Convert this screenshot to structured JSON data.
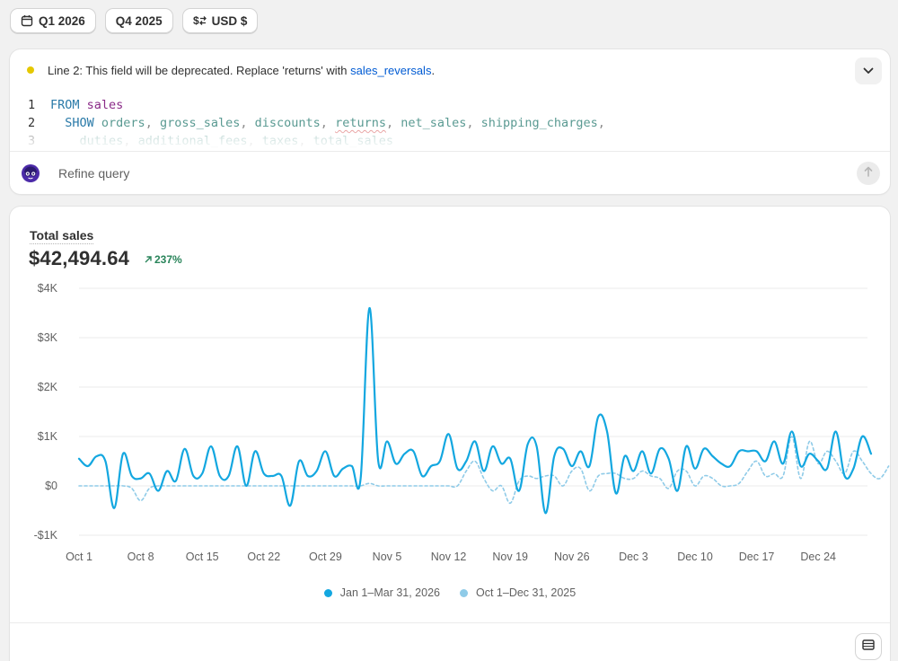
{
  "filters": [
    {
      "label": "Q1 2026",
      "icon": "calendar-icon"
    },
    {
      "label": "Q4 2025",
      "icon": ""
    },
    {
      "label": "USD $",
      "icon": "currency-exchange-icon"
    }
  ],
  "query": {
    "warning": {
      "text": "Line 2: This field will be deprecated. Replace 'returns' with ",
      "replacement": "sales_reversals",
      "suffix": ".",
      "status_color": "#e5c800"
    },
    "code_lines": [
      {
        "number": "1",
        "keyword": "FROM",
        "rest": [
          {
            "t": "sales",
            "c": "id"
          }
        ]
      },
      {
        "number": "2",
        "keyword": "SHOW",
        "rest": [
          {
            "t": "orders",
            "c": "fld"
          },
          {
            "t": ", ",
            "c": "punct"
          },
          {
            "t": "gross_sales",
            "c": "fld"
          },
          {
            "t": ", ",
            "c": "punct"
          },
          {
            "t": "discounts",
            "c": "fld"
          },
          {
            "t": ", ",
            "c": "punct"
          },
          {
            "t": "returns",
            "c": "fld squig"
          },
          {
            "t": ", ",
            "c": "punct"
          },
          {
            "t": "net_sales",
            "c": "fld"
          },
          {
            "t": ", ",
            "c": "punct"
          },
          {
            "t": "shipping_charges",
            "c": "fld"
          },
          {
            "t": ",",
            "c": "punct"
          }
        ]
      },
      {
        "number": "3",
        "keyword": "",
        "rest": [
          {
            "t": "duties",
            "c": "fld"
          },
          {
            "t": ", ",
            "c": "punct"
          },
          {
            "t": "additional_fees",
            "c": "fld"
          },
          {
            "t": ", ",
            "c": "punct"
          },
          {
            "t": "taxes",
            "c": "fld"
          },
          {
            "t": ", ",
            "c": "punct"
          },
          {
            "t": "total_sales",
            "c": "fld"
          }
        ]
      }
    ],
    "refine_placeholder": "Refine query"
  },
  "metric": {
    "title": "Total sales",
    "value": "$42,494.64",
    "change": "237%",
    "change_direction": "up",
    "change_color": "#29845a"
  },
  "chart_data": {
    "type": "line",
    "title": "Total sales",
    "xlabel": "",
    "ylabel": "",
    "ylim": [
      -1000,
      4000
    ],
    "yticks": [
      -1000,
      0,
      1000,
      2000,
      3000,
      4000
    ],
    "ytick_labels": [
      "-$1K",
      "$0",
      "$1K",
      "$2K",
      "$3K",
      "$4K"
    ],
    "x_tick_labels": [
      "Oct 1",
      "Oct 8",
      "Oct 15",
      "Oct 22",
      "Oct 29",
      "Nov 5",
      "Nov 12",
      "Nov 19",
      "Nov 26",
      "Dec 3",
      "Dec 10",
      "Dec 17",
      "Dec 24"
    ],
    "x_tick_every": 7,
    "grid": true,
    "legend_position": "bottom",
    "series": [
      {
        "name": "Jan 1–Mar 31, 2026",
        "color": "#13a7e0",
        "style": "solid",
        "values": [
          550,
          400,
          600,
          500,
          -450,
          650,
          200,
          150,
          250,
          -100,
          300,
          100,
          750,
          200,
          250,
          800,
          200,
          200,
          800,
          0,
          700,
          250,
          200,
          200,
          -400,
          500,
          200,
          300,
          700,
          200,
          350,
          400,
          150,
          3600,
          500,
          900,
          450,
          650,
          700,
          200,
          400,
          500,
          1050,
          350,
          500,
          900,
          300,
          800,
          450,
          550,
          -100,
          850,
          800,
          -550,
          600,
          750,
          400,
          700,
          400,
          1400,
          1100,
          -150,
          600,
          300,
          700,
          250,
          750,
          550,
          -100,
          800,
          350,
          750,
          600,
          450,
          400,
          700,
          700,
          700,
          500,
          900,
          450,
          1100,
          400,
          650,
          500,
          350,
          1100,
          200,
          350,
          1000,
          650
        ]
      },
      {
        "name": "Oct 1–Dec 31, 2025",
        "color": "#8fcbe8",
        "style": "dashed",
        "values": [
          0,
          0,
          0,
          0,
          0,
          0,
          -50,
          -300,
          -50,
          0,
          0,
          0,
          0,
          0,
          0,
          0,
          0,
          0,
          0,
          0,
          0,
          0,
          0,
          0,
          0,
          0,
          0,
          0,
          0,
          0,
          0,
          0,
          0,
          50,
          0,
          0,
          0,
          0,
          0,
          0,
          0,
          0,
          0,
          0,
          300,
          500,
          150,
          -100,
          0,
          -350,
          100,
          200,
          150,
          200,
          200,
          0,
          300,
          350,
          -100,
          200,
          250,
          250,
          150,
          150,
          300,
          200,
          150,
          -50,
          300,
          300,
          0,
          200,
          150,
          0,
          0,
          50,
          300,
          500,
          200,
          250,
          200,
          1000,
          150,
          900,
          450,
          700,
          500,
          250,
          700,
          500,
          250,
          150,
          400
        ]
      }
    ]
  }
}
